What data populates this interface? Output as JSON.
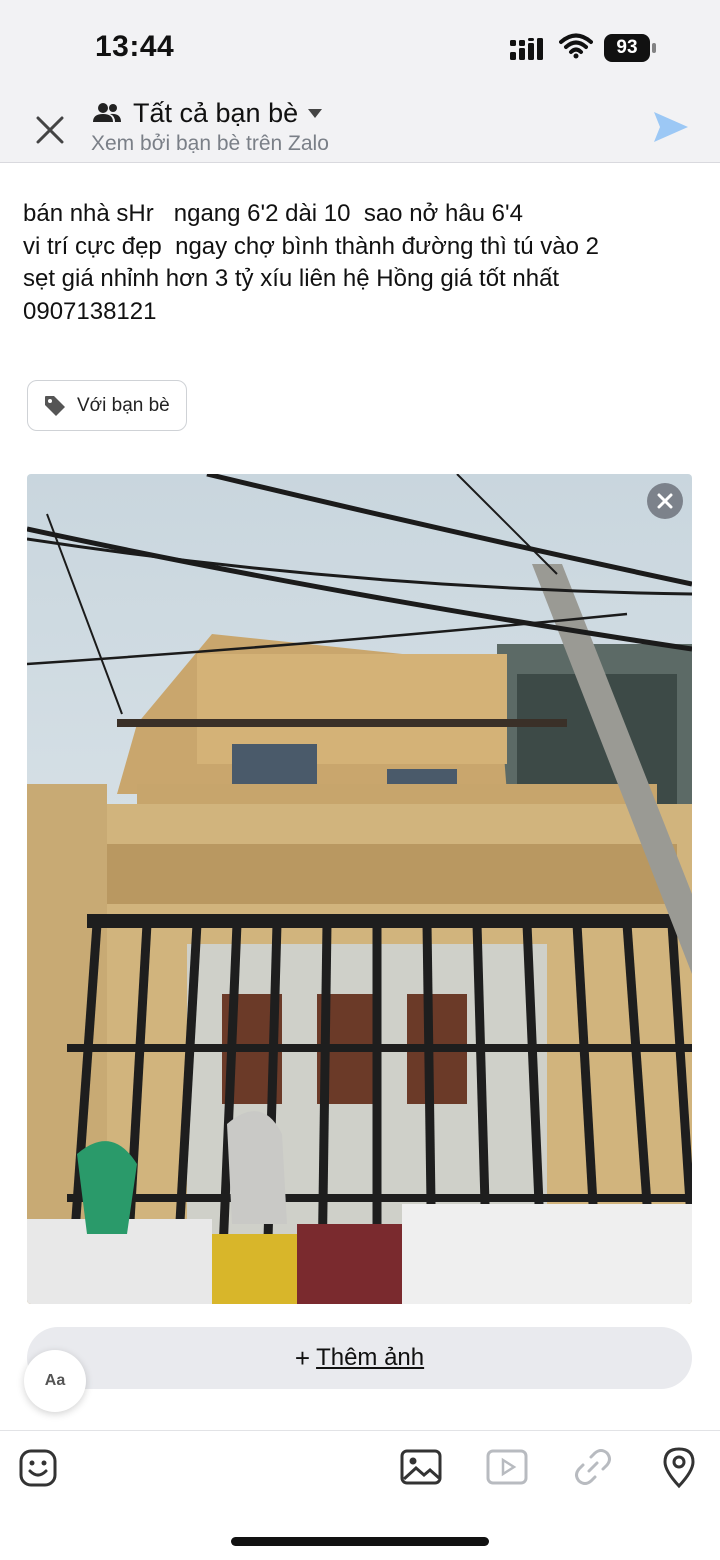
{
  "status_bar": {
    "time": "13:44",
    "battery": "93"
  },
  "header": {
    "audience_title": "Tất cả bạn bè",
    "subtitle": "Xem bởi bạn bè trên Zalo",
    "icons": [
      "close-icon",
      "friends-icon",
      "caret-down-icon",
      "send-icon"
    ]
  },
  "post": {
    "text": "bán nhà sHr   ngang 6'2 dài 10  sao nở hâu 6'4\nvi trí cực đẹp  ngay chợ bình thành đường thì tú vào 2\nsẹt giá nhỉnh hơn 3 tỷ xíu liên hệ Hồng giá tốt nhất\n0907138121"
  },
  "tag_chip": {
    "label": "Với bạn bè",
    "icon": "tag-icon"
  },
  "photo": {
    "description_icon": "remove-photo-icon"
  },
  "add_photo": {
    "plus": "+",
    "label": "Thêm ảnh"
  },
  "font_button": {
    "label": "Aa"
  },
  "toolbar": {
    "items": [
      "sticker-icon",
      "image-icon",
      "video-icon",
      "link-icon",
      "location-icon"
    ]
  },
  "colors": {
    "accent": "#1a8cff",
    "header_bg": "#f2f2f4",
    "chip_border": "#cfd2d6"
  }
}
